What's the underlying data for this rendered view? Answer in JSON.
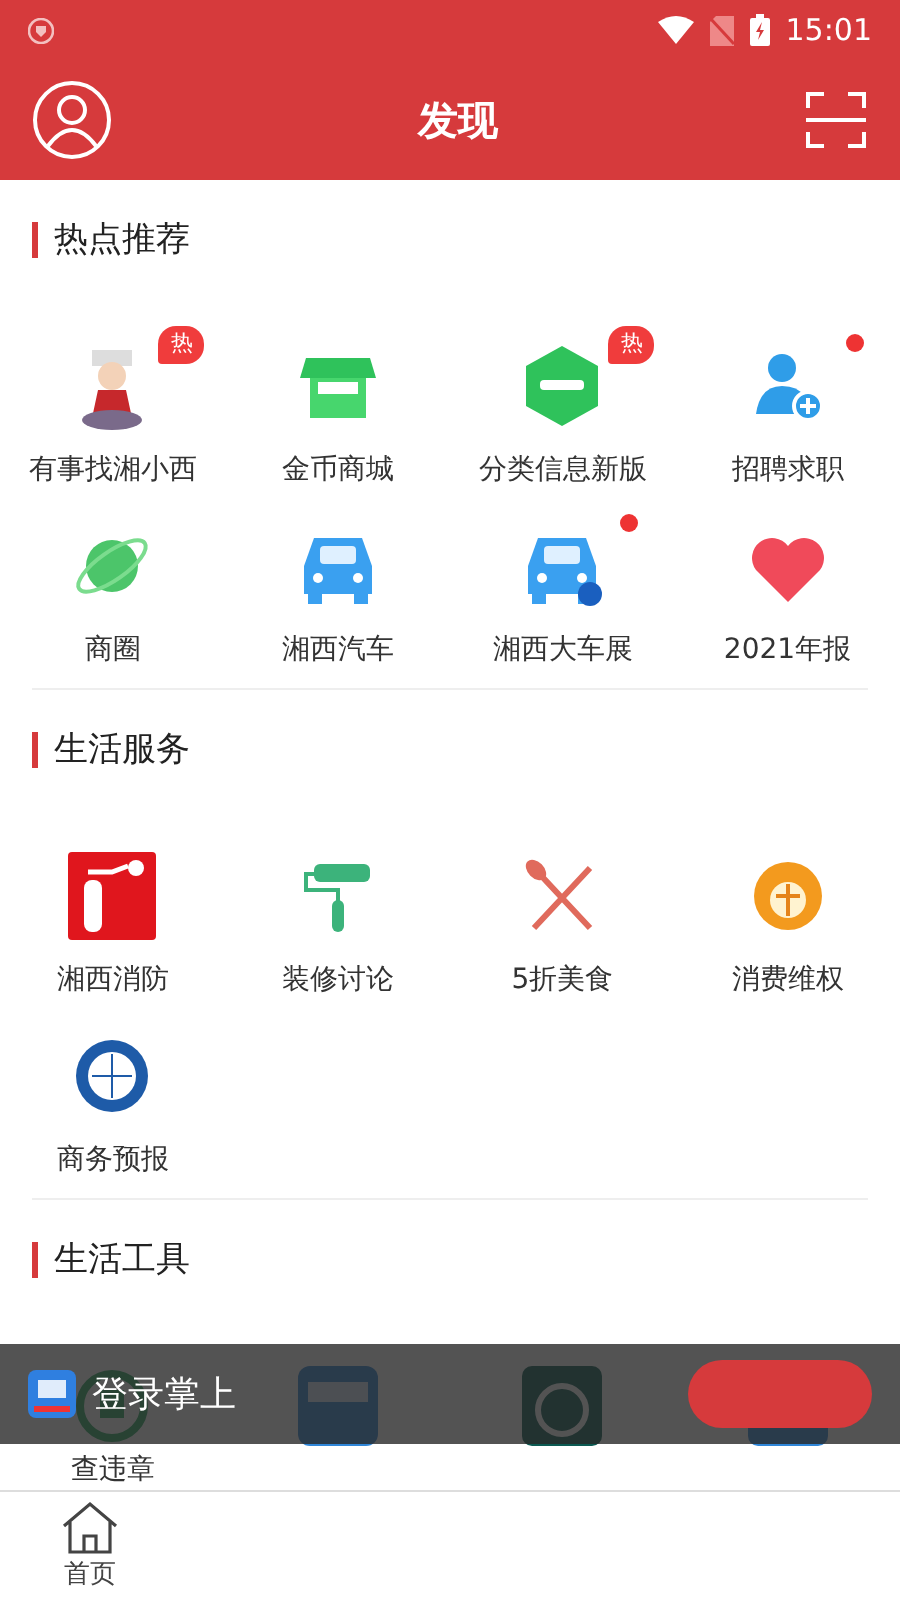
{
  "status_bar": {
    "time": "15:01"
  },
  "header": {
    "title": "发现"
  },
  "sections": [
    {
      "title": "热点推荐",
      "items": [
        {
          "label": "有事找湘小西",
          "badge": "热",
          "dot": false
        },
        {
          "label": "金币商城",
          "dot": false
        },
        {
          "label": "分类信息新版",
          "badge": "热",
          "dot": false
        },
        {
          "label": "招聘求职",
          "dot": true
        },
        {
          "label": "商圈",
          "dot": false
        },
        {
          "label": "湘西汽车",
          "dot": false
        },
        {
          "label": "湘西大车展",
          "dot": true
        },
        {
          "label": "2021年报",
          "dot": false
        }
      ]
    },
    {
      "title": "生活服务",
      "items": [
        {
          "label": "湘西消防",
          "dot": false
        },
        {
          "label": "装修讨论",
          "dot": false
        },
        {
          "label": "5折美食",
          "dot": false
        },
        {
          "label": "消费维权",
          "dot": false
        },
        {
          "label": "商务预报",
          "dot": false
        }
      ]
    },
    {
      "title": "生活工具",
      "items": [
        {
          "label": "查违章",
          "dot": false
        },
        {
          "dot": false
        },
        {
          "dot": false
        },
        {
          "dot": false
        }
      ]
    }
  ],
  "login_banner": {
    "text": "登录掌上"
  },
  "tab_bar": [
    {
      "label": "首页",
      "selected": false
    }
  ]
}
